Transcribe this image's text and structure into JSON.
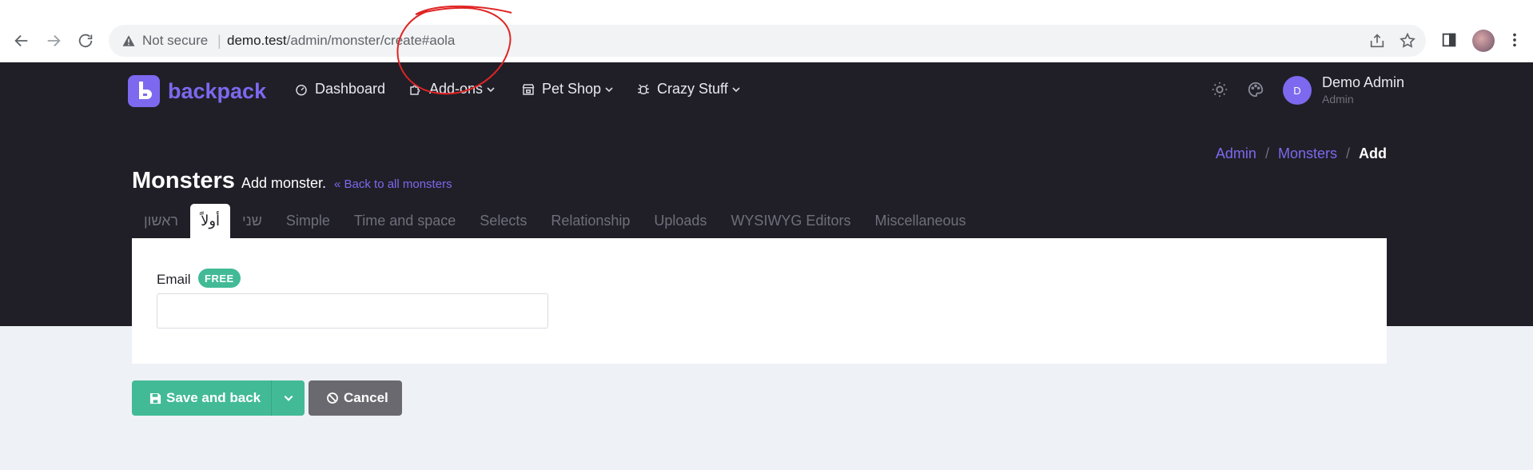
{
  "browser": {
    "security_label": "Not secure",
    "url_host": "demo.test",
    "url_path": "/admin/monster/create#aola",
    "icons": [
      "back-arrow-icon",
      "forward-arrow-icon",
      "reload-icon",
      "warning-icon",
      "share-icon",
      "star-icon",
      "sidebar-icon",
      "profile-avatar",
      "kebab-menu-icon"
    ]
  },
  "brand": {
    "name": "backpack",
    "color": "#7c69ef"
  },
  "menu": [
    {
      "label": "Dashboard",
      "icon": "gauge-icon"
    },
    {
      "label": "Add-ons",
      "icon": "puzzle-icon"
    },
    {
      "label": "Pet Shop",
      "icon": "store-icon"
    },
    {
      "label": "Crazy Stuff",
      "icon": "bug-icon"
    }
  ],
  "user": {
    "initial": "D",
    "name": "Demo Admin",
    "role": "Admin"
  },
  "breadcrumb": {
    "items": [
      "Admin",
      "Monsters"
    ],
    "separator": "/",
    "active": "Add"
  },
  "page": {
    "title": "Monsters",
    "subtitle": "Add monster.",
    "back_link": "Back to all monsters"
  },
  "tabs": [
    {
      "label": "ראשון",
      "active": false
    },
    {
      "label": "أولاً",
      "active": true
    },
    {
      "label": "שני",
      "active": false
    },
    {
      "label": "Simple",
      "active": false
    },
    {
      "label": "Time and space",
      "active": false
    },
    {
      "label": "Selects",
      "active": false
    },
    {
      "label": "Relationship",
      "active": false
    },
    {
      "label": "Uploads",
      "active": false
    },
    {
      "label": "WYSIWYG Editors",
      "active": false
    },
    {
      "label": "Miscellaneous",
      "active": false
    }
  ],
  "form": {
    "email_label": "Email",
    "email_badge": "FREE",
    "email_value": "",
    "badge_color": "#42ba96"
  },
  "actions": {
    "save_label": "Save and back",
    "cancel_label": "Cancel",
    "save_color": "#42ba96",
    "cancel_color": "#69696f"
  }
}
